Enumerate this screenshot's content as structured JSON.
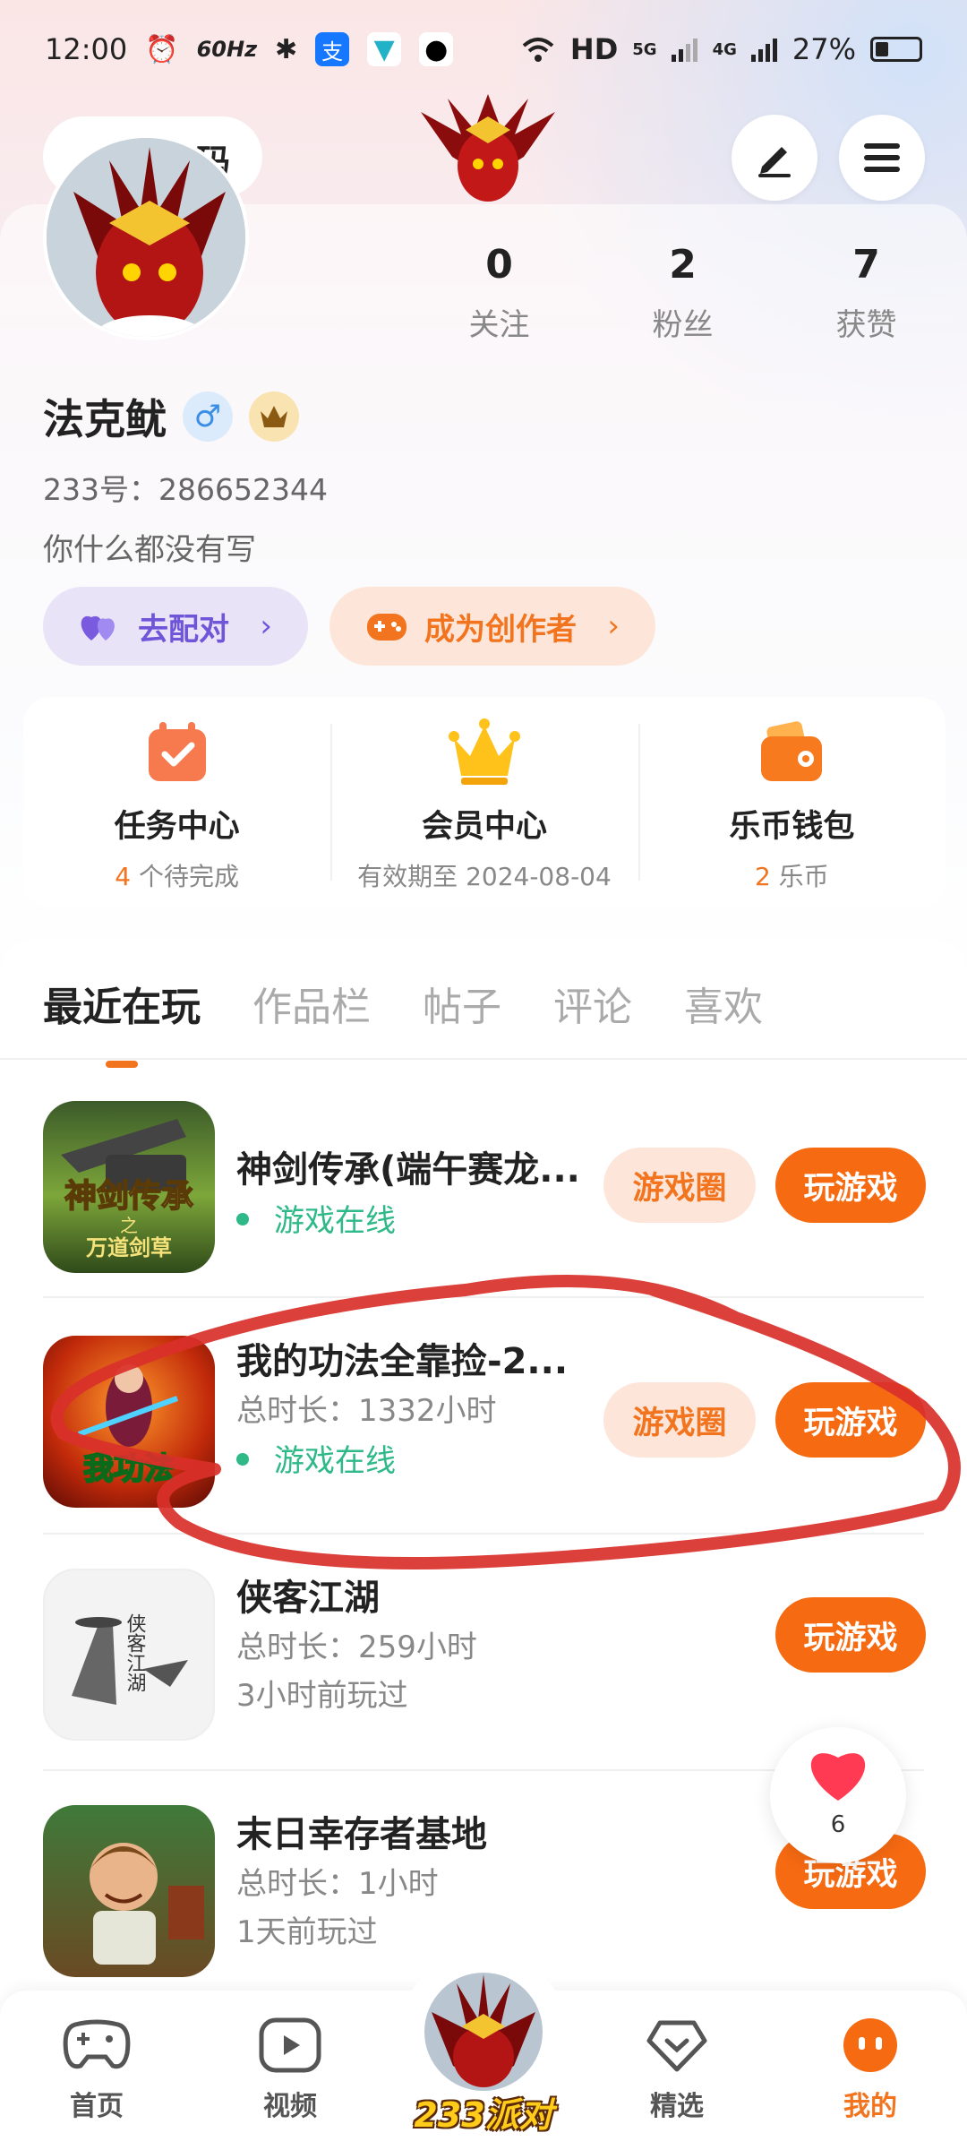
{
  "status_bar": {
    "time": "12:00",
    "refresh_rate": "60Hz",
    "network": "HD",
    "signal_1": "5G",
    "signal_2": "4G",
    "battery": "27%"
  },
  "header": {
    "scan_text": "码"
  },
  "profile": {
    "name": "法克鱿",
    "id_text": "233号：286652344",
    "bio": "你什么都没有写",
    "stats": [
      {
        "value": "0",
        "label": "关注"
      },
      {
        "value": "2",
        "label": "粉丝"
      },
      {
        "value": "7",
        "label": "获赞"
      }
    ],
    "match_label": "去配对",
    "creator_label": "成为创作者",
    "chevron": "›"
  },
  "quick_cards": [
    {
      "title": "任务中心",
      "sub_highlight": "4",
      "sub_text": " 个待完成",
      "icon": "task-calendar-icon"
    },
    {
      "title": "会员中心",
      "sub_highlight": "",
      "sub_text": "有效期至 2024-08-04",
      "icon": "vip-crown-icon"
    },
    {
      "title": "乐币钱包",
      "sub_highlight": "2",
      "sub_text": " 乐币",
      "icon": "wallet-icon"
    }
  ],
  "tabs": [
    "最近在玩",
    "作品栏",
    "帖子",
    "评论",
    "喜欢"
  ],
  "games": [
    {
      "title": "神剑传承(端午赛龙...",
      "line1": "",
      "line2": "游戏在线",
      "circle_btn": "游戏圈",
      "play_btn": "玩游戏"
    },
    {
      "title": "我的功法全靠捡-2...",
      "line1": "总时长：1332小时",
      "line2": "游戏在线",
      "circle_btn": "游戏圈",
      "play_btn": "玩游戏"
    },
    {
      "title": "侠客江湖",
      "line1": "总时长：259小时",
      "line2": "3小时前玩过",
      "play_btn": "玩游戏"
    },
    {
      "title": "末日幸存者基地",
      "line1": "总时长：1小时",
      "line2": "1天前玩过",
      "play_btn": "玩游戏"
    }
  ],
  "thumb_text": {
    "game1_art": "神剑传承",
    "game1_sub": "之",
    "game1_sub2": "万道剑草",
    "game2_art": "我功法",
    "game3_art": "侠客江湖"
  },
  "float_heart_count": "6",
  "bottom_nav": {
    "home": "首页",
    "video": "视频",
    "center": "233派对",
    "featured": "精选",
    "mine": "我的"
  },
  "colors": {
    "accent": "#f66a12",
    "online": "#2fb988",
    "annotation": "#d9302a"
  }
}
